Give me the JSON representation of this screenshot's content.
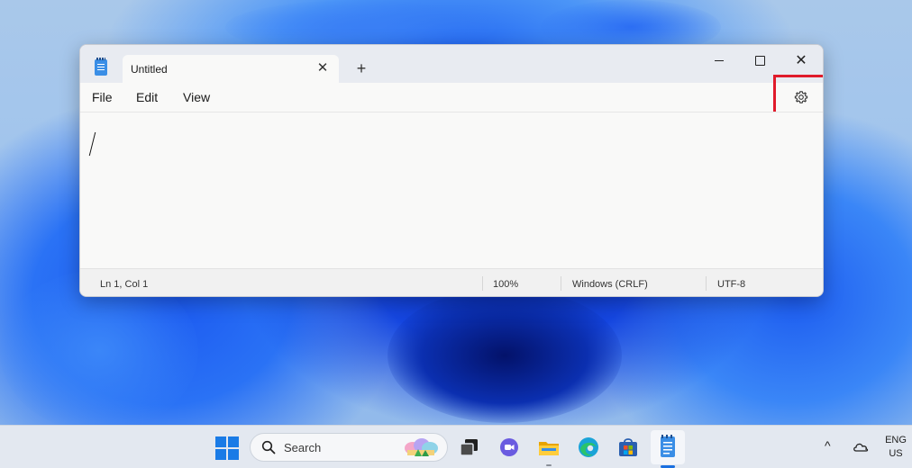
{
  "notepad": {
    "tab_title": "Untitled",
    "tab_close_glyph": "✕",
    "new_tab_glyph": "+",
    "close_glyph": "✕",
    "menu": [
      "File",
      "Edit",
      "View"
    ],
    "settings_icon": "gear-icon",
    "status": {
      "position": "Ln 1, Col 1",
      "zoom": "100%",
      "line_ending": "Windows (CRLF)",
      "encoding": "UTF-8"
    },
    "highlight_color": "#e01b2b"
  },
  "taskbar": {
    "search_label": "Search",
    "tray_chevron": "^",
    "lang_line1": "ENG",
    "lang_line2": "US",
    "apps": [
      "start-icon",
      "search-icon",
      "task-view-icon",
      "teams-chat-icon",
      "file-explorer-icon",
      "edge-icon",
      "microsoft-store-icon",
      "notepad-icon"
    ]
  },
  "colors": {
    "accent": "#1a6fe0",
    "taskbar_bg": "#e3e8f0",
    "window_bg": "#f9f9f8"
  }
}
